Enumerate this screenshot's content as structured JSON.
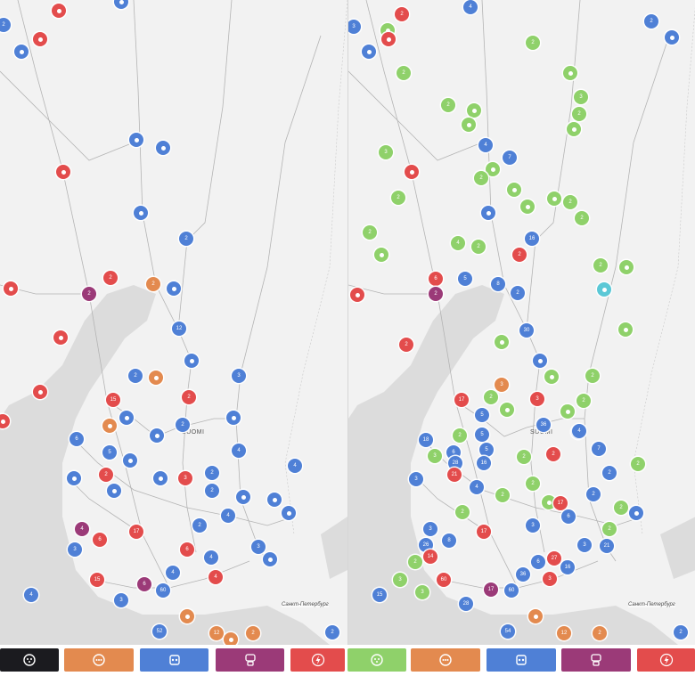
{
  "left_map": {
    "country_label": "SUOMI",
    "city_label": "Санкт-Петербург",
    "markers": [
      {
        "color": "#e34c4c",
        "text": ""
      },
      {
        "color": "#4f80d6",
        "text": "2"
      },
      {
        "color": "#e34c4c",
        "text": ""
      },
      {
        "color": "#4f80d6",
        "text": ""
      },
      {
        "color": "#4f80d6",
        "text": ""
      },
      {
        "color": "#4f80d6",
        "text": ""
      },
      {
        "color": "#4f80d6",
        "text": ""
      },
      {
        "color": "#e34c4c",
        "text": ""
      },
      {
        "color": "#4f80d6",
        "text": ""
      },
      {
        "color": "#4f80d6",
        "text": "2"
      },
      {
        "color": "#e34c4c",
        "text": ""
      },
      {
        "color": "#e34c4c",
        "text": "2"
      },
      {
        "color": "#9b3a78",
        "text": "2"
      },
      {
        "color": "#e38a4f",
        "text": "2"
      },
      {
        "color": "#4f80d6",
        "text": ""
      },
      {
        "color": "#4f80d6",
        "text": "12"
      },
      {
        "color": "#e34c4c",
        "text": ""
      },
      {
        "color": "#4f80d6",
        "text": ""
      },
      {
        "color": "#4f80d6",
        "text": "2"
      },
      {
        "color": "#e38a4f",
        "text": ""
      },
      {
        "color": "#4f80d6",
        "text": "3"
      },
      {
        "color": "#e34c4c",
        "text": ""
      },
      {
        "color": "#e34c4c",
        "text": "15"
      },
      {
        "color": "#e34c4c",
        "text": "2"
      },
      {
        "color": "#4f80d6",
        "text": ""
      },
      {
        "color": "#e38a4f",
        "text": ""
      },
      {
        "color": "#4f80d6",
        "text": "2"
      },
      {
        "color": "#4f80d6",
        "text": ""
      },
      {
        "color": "#4f80d6",
        "text": "6"
      },
      {
        "color": "#4f80d6",
        "text": ""
      },
      {
        "color": "#4f80d6",
        "text": "5"
      },
      {
        "color": "#4f80d6",
        "text": ""
      },
      {
        "color": "#4f80d6",
        "text": "4"
      },
      {
        "color": "#4f80d6",
        "text": "4"
      },
      {
        "color": "#e34c4c",
        "text": "3"
      },
      {
        "color": "#4f80d6",
        "text": "2"
      },
      {
        "color": "#e34c4c",
        "text": "2"
      },
      {
        "color": "#4f80d6",
        "text": ""
      },
      {
        "color": "#4f80d6",
        "text": ""
      },
      {
        "color": "#4f80d6",
        "text": ""
      },
      {
        "color": "#4f80d6",
        "text": "2"
      },
      {
        "color": "#4f80d6",
        "text": ""
      },
      {
        "color": "#4f80d6",
        "text": ""
      },
      {
        "color": "#4f80d6",
        "text": ""
      },
      {
        "color": "#4f80d6",
        "text": "2"
      },
      {
        "color": "#4f80d6",
        "text": "4"
      },
      {
        "color": "#9b3a78",
        "text": "4"
      },
      {
        "color": "#e34c4c",
        "text": "6"
      },
      {
        "color": "#e34c4c",
        "text": "17"
      },
      {
        "color": "#4f80d6",
        "text": "3"
      },
      {
        "color": "#e34c4c",
        "text": "6"
      },
      {
        "color": "#4f80d6",
        "text": "3"
      },
      {
        "color": "#4f80d6",
        "text": "4"
      },
      {
        "color": "#4f80d6",
        "text": ""
      },
      {
        "color": "#e34c4c",
        "text": "15"
      },
      {
        "color": "#4f80d6",
        "text": "4"
      },
      {
        "color": "#e34c4c",
        "text": "4"
      },
      {
        "color": "#9b3a78",
        "text": "6"
      },
      {
        "color": "#4f80d6",
        "text": "60"
      },
      {
        "color": "#4f80d6",
        "text": "4"
      },
      {
        "color": "#4f80d6",
        "text": "3"
      },
      {
        "color": "#e38a4f",
        "text": ""
      },
      {
        "color": "#4f80d6",
        "text": "52"
      },
      {
        "color": "#e38a4f",
        "text": "12"
      },
      {
        "color": "#e38a4f",
        "text": "2"
      },
      {
        "color": "#e38a4f",
        "text": ""
      },
      {
        "color": "#4f80d6",
        "text": "2"
      },
      {
        "color": "#e34c4c",
        "text": ""
      }
    ]
  },
  "right_map": {
    "country_label": "SUOMI",
    "city_label": "Санкт-Петербург",
    "markers": [
      {
        "color": "#e34c4c",
        "text": "2"
      },
      {
        "color": "#4f80d6",
        "text": "4"
      },
      {
        "color": "#4f80d6",
        "text": "2"
      },
      {
        "color": "#4f80d6",
        "text": ""
      },
      {
        "color": "#4f80d6",
        "text": "3"
      },
      {
        "color": "#8fd16a",
        "text": ""
      },
      {
        "color": "#e34c4c",
        "text": ""
      },
      {
        "color": "#4f80d6",
        "text": ""
      },
      {
        "color": "#8fd16a",
        "text": "2"
      },
      {
        "color": "#8fd16a",
        "text": "2"
      },
      {
        "color": "#8fd16a",
        "text": ""
      },
      {
        "color": "#8fd16a",
        "text": "3"
      },
      {
        "color": "#8fd16a",
        "text": "2"
      },
      {
        "color": "#8fd16a",
        "text": ""
      },
      {
        "color": "#8fd16a",
        "text": "2"
      },
      {
        "color": "#8fd16a",
        "text": ""
      },
      {
        "color": "#8fd16a",
        "text": ""
      },
      {
        "color": "#4f80d6",
        "text": "4"
      },
      {
        "color": "#4f80d6",
        "text": "7"
      },
      {
        "color": "#8fd16a",
        "text": "3"
      },
      {
        "color": "#e34c4c",
        "text": ""
      },
      {
        "color": "#8fd16a",
        "text": ""
      },
      {
        "color": "#8fd16a",
        "text": "2"
      },
      {
        "color": "#8fd16a",
        "text": ""
      },
      {
        "color": "#4f80d6",
        "text": ""
      },
      {
        "color": "#8fd16a",
        "text": "2"
      },
      {
        "color": "#8fd16a",
        "text": ""
      },
      {
        "color": "#8fd16a",
        "text": "2"
      },
      {
        "color": "#8fd16a",
        "text": ""
      },
      {
        "color": "#8fd16a",
        "text": "2"
      },
      {
        "color": "#4f80d6",
        "text": "16"
      },
      {
        "color": "#8fd16a",
        "text": "2"
      },
      {
        "color": "#8fd16a",
        "text": "4"
      },
      {
        "color": "#8fd16a",
        "text": ""
      },
      {
        "color": "#8fd16a",
        "text": "2"
      },
      {
        "color": "#e34c4c",
        "text": "2"
      },
      {
        "color": "#e34c4c",
        "text": "6"
      },
      {
        "color": "#9b3a78",
        "text": "2"
      },
      {
        "color": "#4f80d6",
        "text": "5"
      },
      {
        "color": "#4f80d6",
        "text": "8"
      },
      {
        "color": "#4f80d6",
        "text": "2"
      },
      {
        "color": "#5bc8d6",
        "text": ""
      },
      {
        "color": "#8fd16a",
        "text": "2"
      },
      {
        "color": "#8fd16a",
        "text": ""
      },
      {
        "color": "#4f80d6",
        "text": "30"
      },
      {
        "color": "#8fd16a",
        "text": ""
      },
      {
        "color": "#8fd16a",
        "text": ""
      },
      {
        "color": "#e34c4c",
        "text": "2"
      },
      {
        "color": "#e34c4c",
        "text": ""
      },
      {
        "color": "#4f80d6",
        "text": ""
      },
      {
        "color": "#8fd16a",
        "text": ""
      },
      {
        "color": "#8fd16a",
        "text": "2"
      },
      {
        "color": "#e34c4c",
        "text": "17"
      },
      {
        "color": "#4f80d6",
        "text": "5"
      },
      {
        "color": "#e38a4f",
        "text": "3"
      },
      {
        "color": "#e34c4c",
        "text": "3"
      },
      {
        "color": "#4f80d6",
        "text": "36"
      },
      {
        "color": "#8fd16a",
        "text": "2"
      },
      {
        "color": "#8fd16a",
        "text": ""
      },
      {
        "color": "#4f80d6",
        "text": "3"
      },
      {
        "color": "#8fd16a",
        "text": ""
      },
      {
        "color": "#4f80d6",
        "text": "5"
      },
      {
        "color": "#8fd16a",
        "text": "2"
      },
      {
        "color": "#4f80d6",
        "text": "18"
      },
      {
        "color": "#4f80d6",
        "text": "6"
      },
      {
        "color": "#4f80d6",
        "text": "5"
      },
      {
        "color": "#8fd16a",
        "text": "2"
      },
      {
        "color": "#4f80d6",
        "text": "4"
      },
      {
        "color": "#4f80d6",
        "text": "28"
      },
      {
        "color": "#8fd16a",
        "text": "3"
      },
      {
        "color": "#8fd16a",
        "text": "2"
      },
      {
        "color": "#4f80d6",
        "text": "16"
      },
      {
        "color": "#8fd16a",
        "text": "2"
      },
      {
        "color": "#4f80d6",
        "text": "7"
      },
      {
        "color": "#e34c4c",
        "text": "2"
      },
      {
        "color": "#4f80d6",
        "text": "2"
      },
      {
        "color": "#8fd16a",
        "text": "2"
      },
      {
        "color": "#e34c4c",
        "text": "21"
      },
      {
        "color": "#4f80d6",
        "text": "3"
      },
      {
        "color": "#4f80d6",
        "text": "4"
      },
      {
        "color": "#8fd16a",
        "text": "2"
      },
      {
        "color": "#8fd16a",
        "text": ""
      },
      {
        "color": "#4f80d6",
        "text": "2"
      },
      {
        "color": "#e34c4c",
        "text": "17"
      },
      {
        "color": "#4f80d6",
        "text": "6"
      },
      {
        "color": "#4f80d6",
        "text": "3"
      },
      {
        "color": "#4f80d6",
        "text": "3"
      },
      {
        "color": "#4f80d6",
        "text": "8"
      },
      {
        "color": "#8fd16a",
        "text": "2"
      },
      {
        "color": "#e34c4c",
        "text": "17"
      },
      {
        "color": "#4f80d6",
        "text": "26"
      },
      {
        "color": "#e34c4c",
        "text": "14"
      },
      {
        "color": "#e34c4c",
        "text": "27"
      },
      {
        "color": "#4f80d6",
        "text": "3"
      },
      {
        "color": "#4f80d6",
        "text": "21"
      },
      {
        "color": "#4f80d6",
        "text": "16"
      },
      {
        "color": "#4f80d6",
        "text": ""
      },
      {
        "color": "#8fd16a",
        "text": "2"
      },
      {
        "color": "#8fd16a",
        "text": "2"
      },
      {
        "color": "#4f80d6",
        "text": "36"
      },
      {
        "color": "#e34c4c",
        "text": "3"
      },
      {
        "color": "#4f80d6",
        "text": "6"
      },
      {
        "color": "#8fd16a",
        "text": "2"
      },
      {
        "color": "#8fd16a",
        "text": "3"
      },
      {
        "color": "#e34c4c",
        "text": "60"
      },
      {
        "color": "#9b3a78",
        "text": "17"
      },
      {
        "color": "#4f80d6",
        "text": "60"
      },
      {
        "color": "#4f80d6",
        "text": "15"
      },
      {
        "color": "#8fd16a",
        "text": "3"
      },
      {
        "color": "#4f80d6",
        "text": "28"
      },
      {
        "color": "#e38a4f",
        "text": ""
      },
      {
        "color": "#4f80d6",
        "text": "54"
      },
      {
        "color": "#e38a4f",
        "text": "12"
      },
      {
        "color": "#e38a4f",
        "text": "2"
      },
      {
        "color": "#4f80d6",
        "text": "2"
      }
    ]
  },
  "toolbar": {
    "buttons": [
      {
        "name": "filter-ccs-button",
        "color": "#1b1b1f",
        "icon": "ccs-connector-icon"
      },
      {
        "name": "filter-type2-button",
        "color": "#e38a4f",
        "icon": "type2-connector-icon"
      },
      {
        "name": "filter-chademo-button",
        "color": "#4f80d6",
        "icon": "chademo-connector-icon"
      },
      {
        "name": "filter-combo-button",
        "color": "#9b3a78",
        "icon": "combo-connector-icon"
      },
      {
        "name": "filter-fast-button",
        "color": "#e34c4c",
        "icon": "lightning-icon"
      },
      {
        "name": "filter-all-button",
        "color": "#8fd16a",
        "icon": "ccs-connector-icon"
      },
      {
        "name": "filter-type2-button-2",
        "color": "#e38a4f",
        "icon": "type2-connector-icon"
      },
      {
        "name": "filter-chademo-button-2",
        "color": "#4f80d6",
        "icon": "chademo-connector-icon"
      },
      {
        "name": "filter-combo-button-2",
        "color": "#9b3a78",
        "icon": "combo-connector-icon"
      },
      {
        "name": "filter-fast-button-2",
        "color": "#e34c4c",
        "icon": "lightning-icon"
      }
    ]
  }
}
